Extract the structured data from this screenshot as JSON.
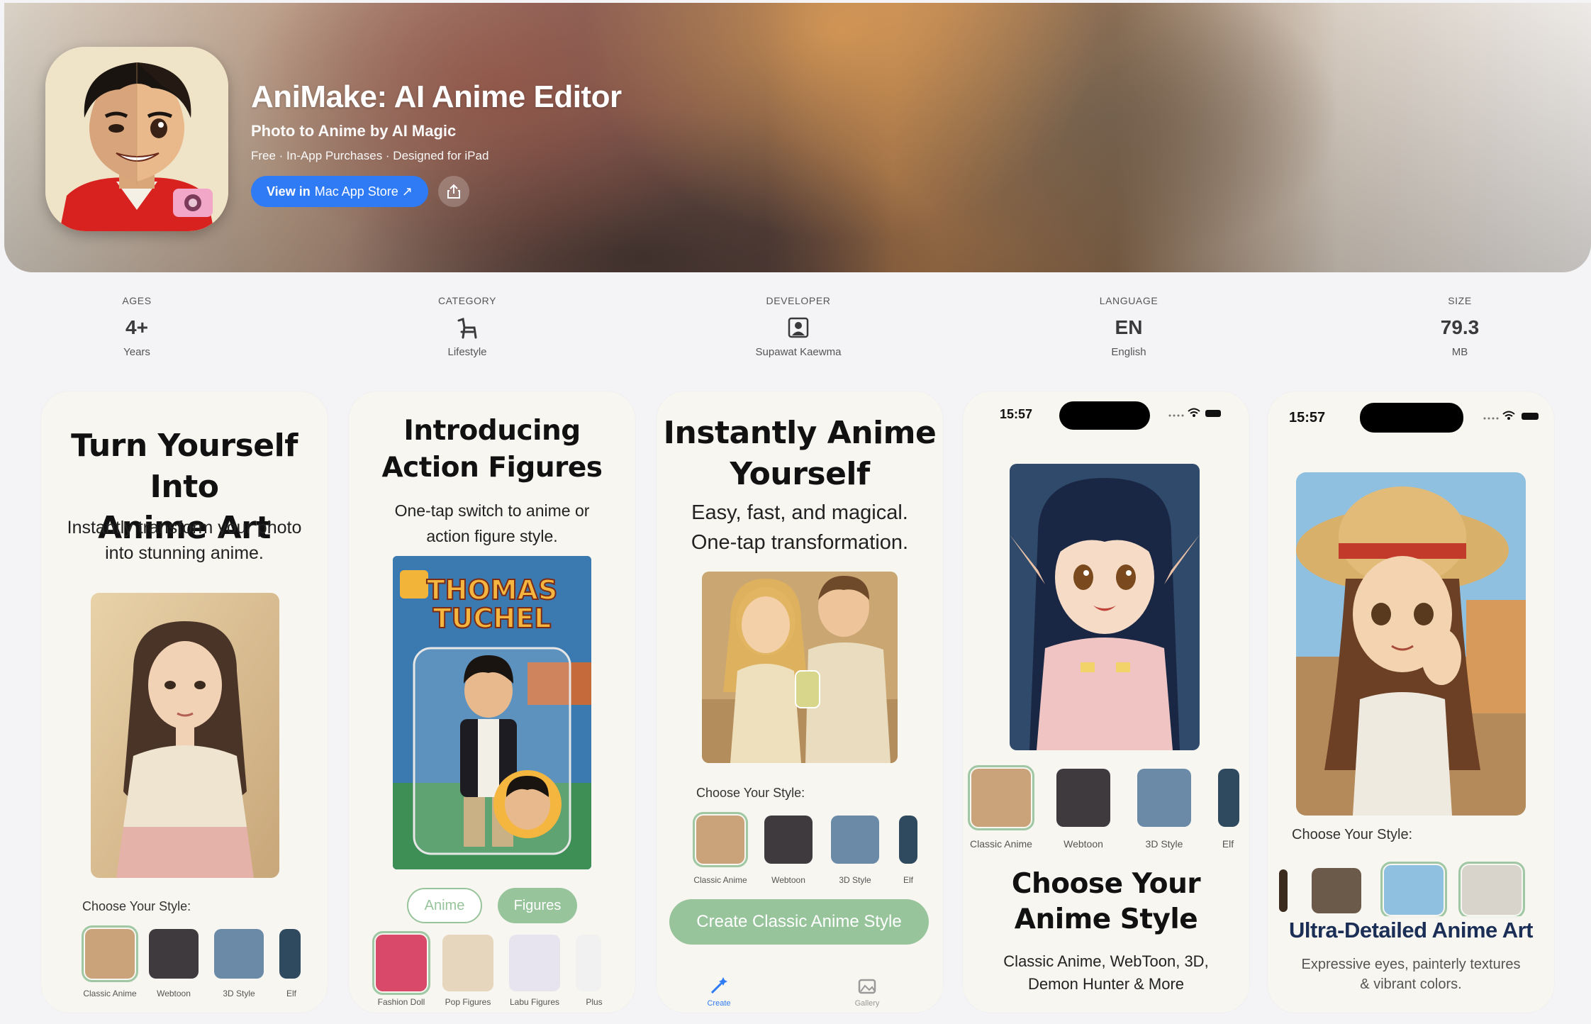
{
  "app": {
    "title": "AniMake: AI Anime Editor",
    "subtitle": "Photo to Anime by AI Magic",
    "meta": "Free · In-App Purchases · Designed for iPad",
    "store_button_bold": "View in",
    "store_button_rest": "Mac App Store ↗"
  },
  "info": [
    {
      "label": "AGES",
      "value": "4+",
      "sub": "Years"
    },
    {
      "label": "CATEGORY",
      "value": "",
      "sub": "Lifestyle",
      "icon": "chair-icon"
    },
    {
      "label": "DEVELOPER",
      "value": "",
      "sub": "Supawat Kaewma",
      "icon": "person-badge-icon"
    },
    {
      "label": "LANGUAGE",
      "value": "EN",
      "sub": "English"
    },
    {
      "label": "SIZE",
      "value": "79.3",
      "sub": "MB"
    }
  ],
  "cards": {
    "c1": {
      "headline_1": "Turn Yourself Into",
      "headline_2": "Anime Art",
      "sub_1": "Instantly transform your photo",
      "sub_2": "into stunning anime.",
      "style_label": "Choose Your Style:",
      "thumbs": [
        "Classic Anime",
        "Webtoon",
        "3D Style",
        "Elf"
      ]
    },
    "c2": {
      "headline_1": "Introducing",
      "headline_2": "Action Figures",
      "sub_1": "One-tap switch to anime or",
      "sub_2": "action figure style.",
      "box_text_1": "THOMAS",
      "box_text_2": "TUCHEL",
      "tab_anime": "Anime",
      "tab_figures": "Figures",
      "thumbs": [
        "Fashion Doll",
        "Pop Figures",
        "Labu Figures",
        "Plus"
      ]
    },
    "c3": {
      "headline_1": "Instantly Anime",
      "headline_2": "Yourself",
      "sub_1": "Easy, fast, and magical.",
      "sub_2": "One-tap transformation.",
      "style_label": "Choose Your Style:",
      "thumbs": [
        "Classic Anime",
        "Webtoon",
        "3D Style",
        "Elf"
      ],
      "cta": "Create Classic Anime Style",
      "nav_create": "Create",
      "nav_gallery": "Gallery"
    },
    "c4": {
      "time": "15:57",
      "thumbs": [
        "Classic Anime",
        "Webtoon",
        "3D Style",
        "Elf"
      ],
      "headline_1": "Choose Your",
      "headline_2": "Anime Style",
      "sub_1": "Classic Anime, WebToon, 3D,",
      "sub_2": "Demon Hunter & More"
    },
    "c5": {
      "time": "15:57",
      "style_label": "Choose Your Style:",
      "headline": "Ultra-Detailed Anime Art",
      "sub_1": "Expressive eyes, painterly textures",
      "sub_2": "& vibrant colors."
    }
  },
  "colors": {
    "accent": "#2f7bf5",
    "cta_green": "#98c49c",
    "card_bg": "#f7f6f0"
  }
}
